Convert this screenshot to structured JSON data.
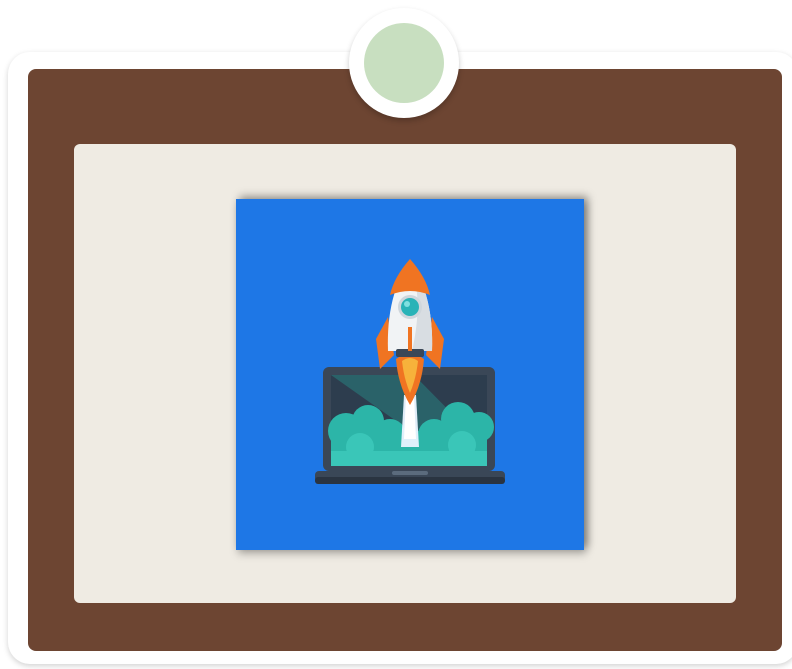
{
  "frame": {
    "pin_color": "#c8dfc0",
    "board_color": "#6d4532",
    "panel_color": "#efebe3"
  },
  "picture": {
    "subject": "rocket-launching-from-laptop",
    "background_color": "#1e77e6",
    "icons": [
      "rocket-icon",
      "laptop-icon"
    ]
  }
}
